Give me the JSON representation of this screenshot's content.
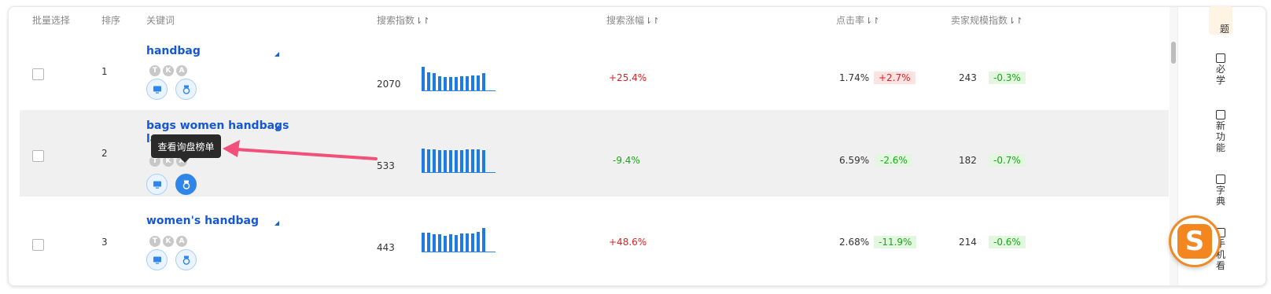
{
  "headers": {
    "select": "批量选择",
    "rank": "排序",
    "keyword": "关键词",
    "search_index": "搜索指数",
    "search_growth": "搜索涨幅",
    "ctr": "点击率",
    "seller_index": "卖家规模指数",
    "sort_icon": "⇂↾"
  },
  "badge_letters": [
    "T",
    "K",
    "A"
  ],
  "rows": [
    {
      "rank": "1",
      "keyword": "handbag",
      "keyword_line2": "",
      "search_index": "2070",
      "growth": "+25.4%",
      "growth_dir": "pos",
      "ctr": "1.74%",
      "ctr_change": "+2.7%",
      "ctr_dir": "pos",
      "seller_index": "243",
      "seller_change": "-0.3%",
      "seller_dir": "neg",
      "spark": [
        1.0,
        0.78,
        0.74,
        0.6,
        0.56,
        0.56,
        0.58,
        0.6,
        0.6,
        0.62,
        0.64,
        0.72
      ]
    },
    {
      "rank": "2",
      "keyword": "bags women handbags",
      "keyword_line2": "la",
      "search_index": "533",
      "growth": "-9.4%",
      "growth_dir": "neg",
      "ctr": "6.59%",
      "ctr_change": "-2.6%",
      "ctr_dir": "neg",
      "seller_index": "182",
      "seller_change": "-0.7%",
      "seller_dir": "neg",
      "spark": [
        1.0,
        0.98,
        0.96,
        0.93,
        0.93,
        0.92,
        0.93,
        0.92,
        0.95,
        0.96,
        0.98,
        0.93
      ]
    },
    {
      "rank": "3",
      "keyword": "women's handbag",
      "keyword_line2": "",
      "search_index": "443",
      "growth": "+48.6%",
      "growth_dir": "pos",
      "ctr": "2.68%",
      "ctr_change": "-11.9%",
      "ctr_dir": "neg",
      "seller_index": "214",
      "seller_change": "-0.6%",
      "seller_dir": "neg",
      "spark": [
        0.8,
        0.8,
        0.74,
        0.74,
        0.68,
        0.72,
        0.7,
        0.76,
        0.78,
        0.78,
        0.84,
        1.0
      ]
    }
  ],
  "tooltip": "查看询盘榜单",
  "right_rail": {
    "top_char": "题",
    "items": [
      {
        "chars": [
          "必",
          "学"
        ],
        "icon": "book-icon"
      },
      {
        "chars": [
          "新",
          "功",
          "能"
        ],
        "icon": "play-icon"
      },
      {
        "chars": [
          "字",
          "典"
        ],
        "icon": "image-icon"
      },
      {
        "chars": [
          "手",
          "机",
          "看"
        ],
        "icon": "phone-icon"
      }
    ]
  },
  "logo_letter": "S",
  "colors": {
    "keyword": "#1557d4",
    "positive": "#e02020",
    "negative": "#18a818",
    "spark": "#1e7be3",
    "annotation_arrow": "#f0507a",
    "logo": "#f3861f"
  }
}
